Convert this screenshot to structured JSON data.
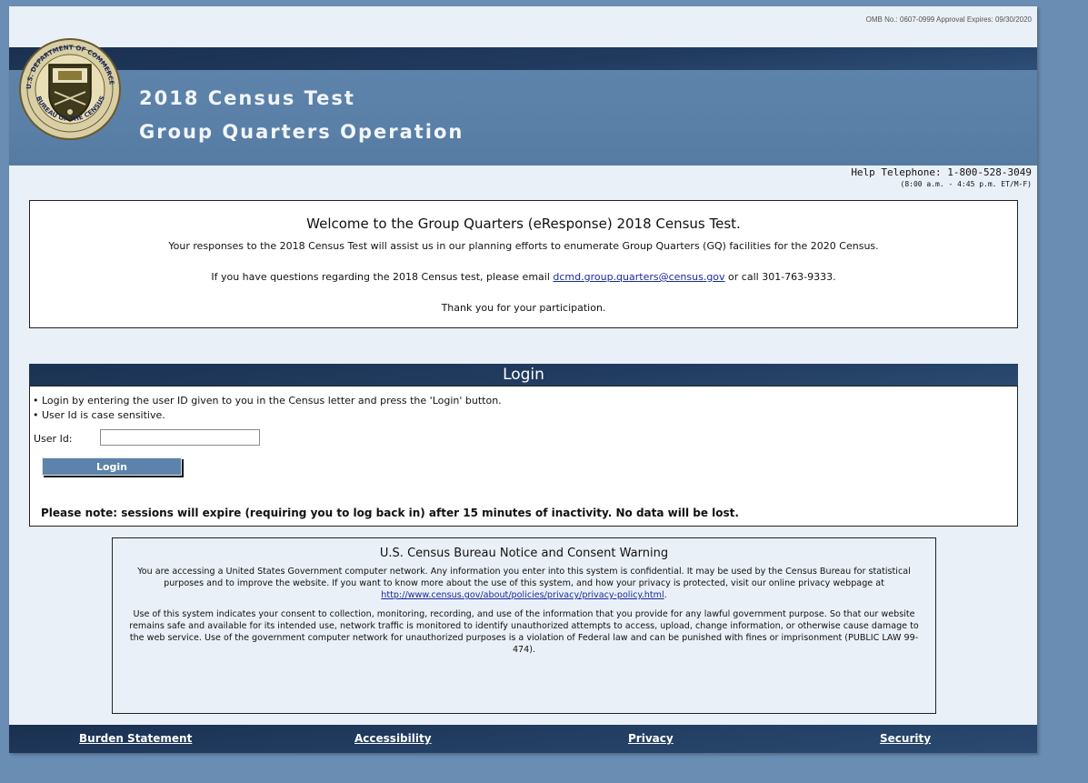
{
  "header": {
    "omb_text": "OMB No.: 0607-0999 Approval Expires: 09/30/2020",
    "title_line1": "2018 Census Test",
    "title_line2": "Group Quarters Operation",
    "seal_icon": "census-bureau-seal-icon",
    "seal_text_top": "U.S. DEPARTMENT OF COMMERCE",
    "seal_text_bottom": "BUREAU OF THE CENSUS"
  },
  "help": {
    "phone": "Help Telephone: 1-800-528-3049",
    "hours": "(8:00 a.m. - 4:45 p.m. ET/M-F)"
  },
  "welcome": {
    "title": "Welcome to the Group Quarters (eResponse) 2018 Census Test.",
    "p1": "Your responses to the 2018 Census Test will assist us in our planning efforts to enumerate Group Quarters (GQ) facilities for the 2020 Census.",
    "p2_before": "If you have questions regarding the 2018 Census test, please email ",
    "p2_email": "dcmd.group.quarters@census.gov",
    "p2_after": " or call 301-763-9333.",
    "p3": "Thank you for your participation."
  },
  "login": {
    "heading": "Login",
    "bullet1": "• Login by entering the user ID given to you in the Census letter and press the 'Login' button.",
    "bullet2": "• User Id is case sensitive.",
    "userid_label": "User Id:",
    "userid_value": "",
    "button_label": "Login",
    "session_note": "Please note: sessions will expire (requiring you to log back in) after 15 minutes of inactivity. No data will be lost."
  },
  "consent": {
    "title": "U.S. Census Bureau Notice and Consent Warning",
    "p1": "You are accessing a United States Government computer network. Any information you enter into this system is confidential. It may be used by the Census Bureau for statistical purposes and to improve the website. If you want to know more about the use of this system, and how your privacy is protected, visit our online privacy webpage at",
    "p1_link": "http://www.census.gov/about/policies/privacy/privacy-policy.html",
    "p1_end": ".",
    "p2": "Use of this system indicates your consent to collection, monitoring, recording, and use of the information that you provide for any lawful government purpose. So that our website remains safe and available for its intended use, network traffic is monitored to identify unauthorized attempts to access, upload, change information, or otherwise cause damage to the web service. Use of the government computer network for unauthorized purposes is a violation of Federal law and can be punished with fines or imprisonment (PUBLIC LAW 99-474)."
  },
  "footer": {
    "burden": "Burden Statement",
    "accessibility": "Accessibility",
    "privacy": "Privacy",
    "security": "Security"
  }
}
